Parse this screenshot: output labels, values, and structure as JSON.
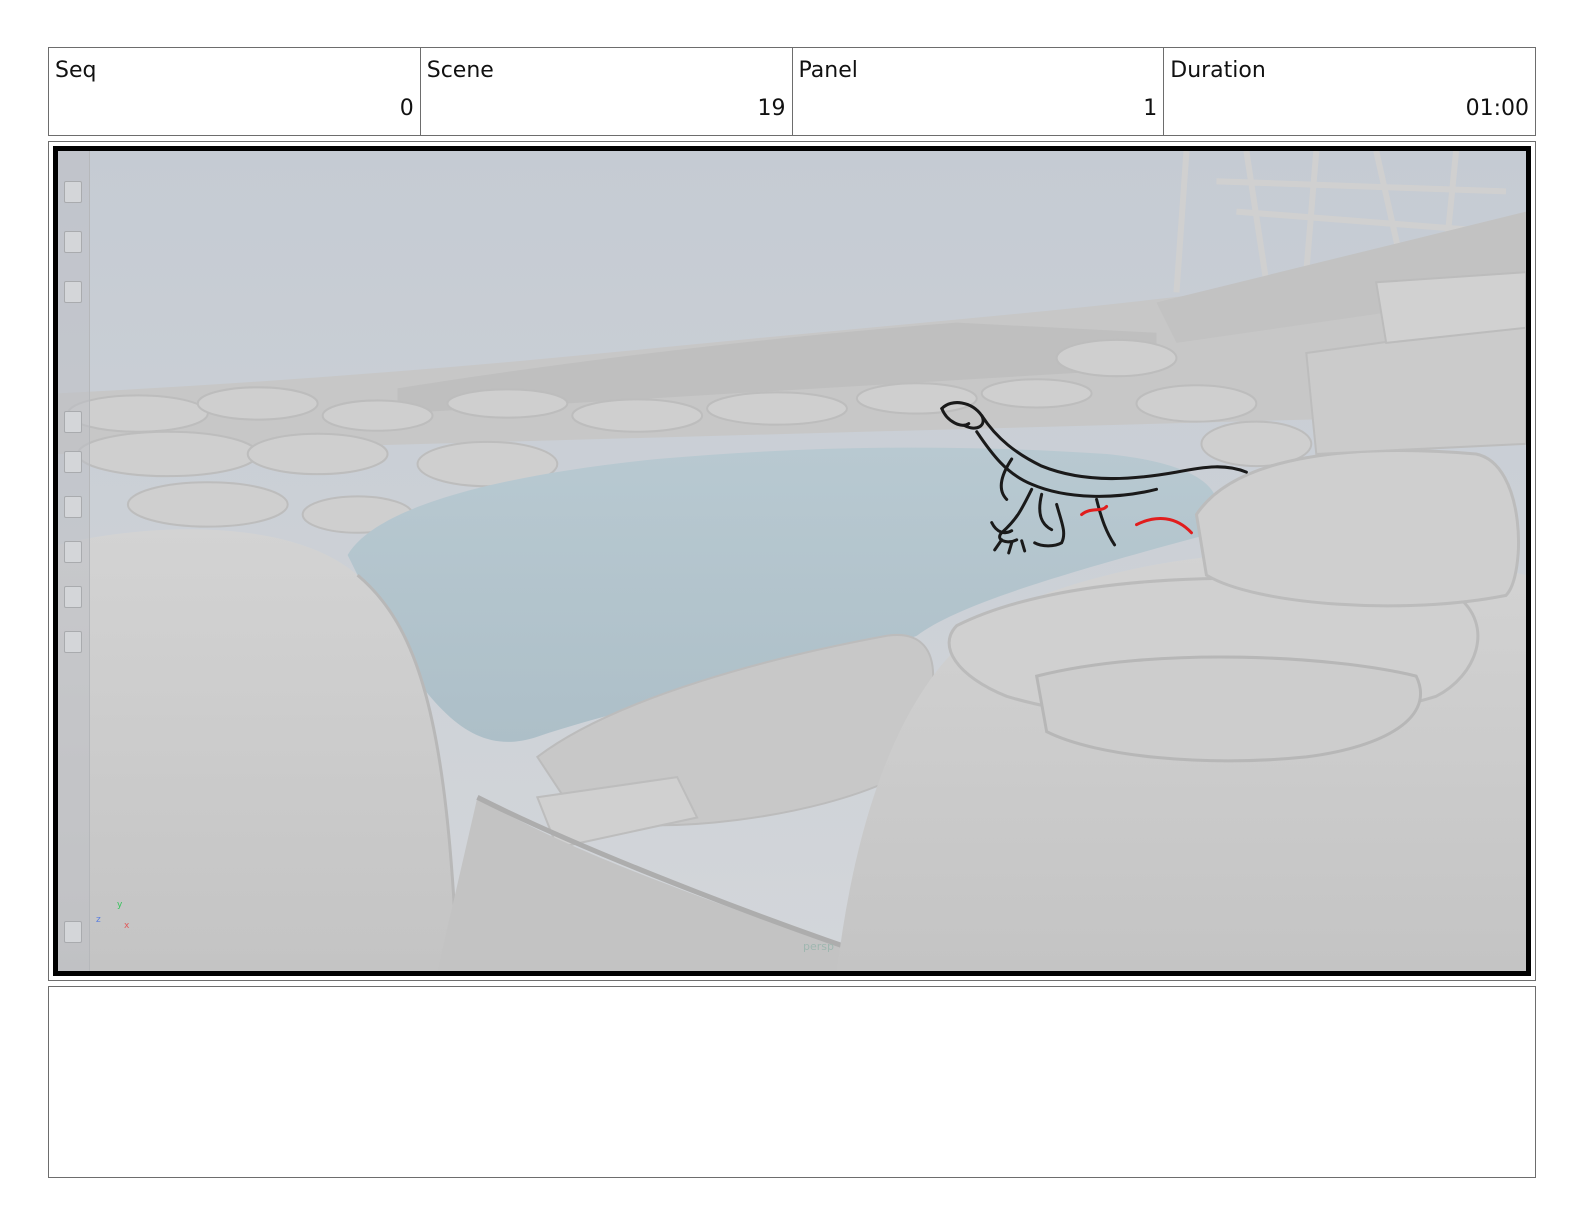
{
  "header": {
    "seq": {
      "label": "Seq",
      "value": "0"
    },
    "scene": {
      "label": "Scene",
      "value": "19"
    },
    "panel": {
      "label": "Panel",
      "value": "1"
    },
    "duration": {
      "label": "Duration",
      "value": "01:00"
    }
  },
  "viewport": {
    "axis_x": "x",
    "axis_y": "y",
    "axis_z": "z",
    "camera_label": "persp"
  },
  "colors": {
    "sky": "#c9ced5",
    "water": "#b2c3cc",
    "rock": "#cacaca",
    "sketch_line": "#1a1a1a",
    "sketch_accent": "#e11d1d"
  },
  "notes": {
    "text": ""
  }
}
